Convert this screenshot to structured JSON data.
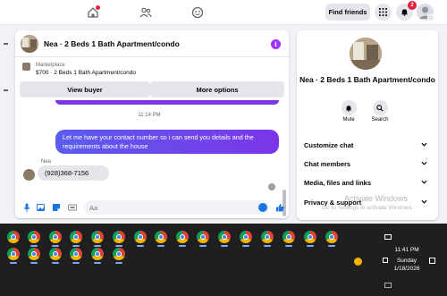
{
  "topnav": {
    "find_friends_label": "Find friends",
    "notification_count": "2"
  },
  "chat": {
    "title": "Nea · 2 Beds 1 Bath Apartment/condo",
    "marketplace": {
      "label": "Marketplace",
      "listing": "$700 · 2 Beds 1 Bath Apartment/condo"
    },
    "view_buyer_label": "View buyer",
    "more_options_label": "More options",
    "timestamp": "11:14 PM",
    "outgoing_message": "Let me have your contact number so i can send you details and the requirements about the house",
    "sender_name": "Nea",
    "incoming_message": "(928)368-7156",
    "composer_placeholder": "Aa"
  },
  "details": {
    "name": "Nea · 2 Beds 1 Bath Apartment/condo",
    "mute_label": "Mute",
    "search_label": "Search",
    "sections": [
      {
        "label": "Customize chat"
      },
      {
        "label": "Chat members"
      },
      {
        "label": "Media, files and links"
      },
      {
        "label": "Privacy & support"
      }
    ]
  },
  "watermark": {
    "title": "Activate Windows",
    "subtitle": "Go to Settings to activate Windows"
  },
  "taskbar": {
    "time": "11:41 PM",
    "day": "Sunday",
    "date": "1/18/2026"
  },
  "colors": {
    "accent": "#7b36e6",
    "blue": "#1b74e4",
    "badge_red": "#e41e3f",
    "taskbar": "#1f1f1f"
  }
}
